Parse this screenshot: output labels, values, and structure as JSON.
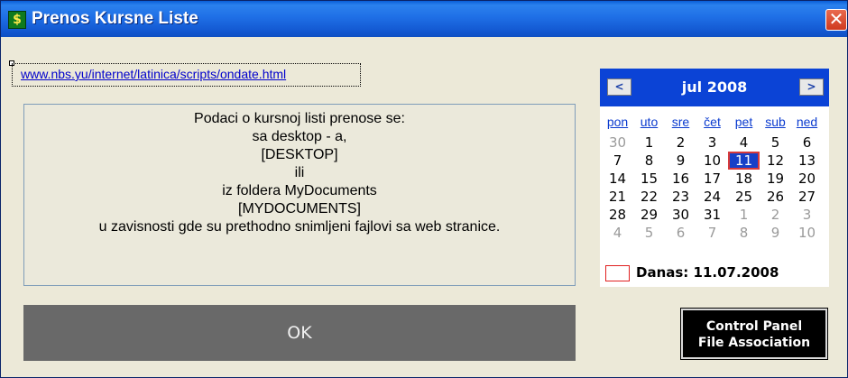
{
  "window": {
    "title": "Prenos Kursne Liste",
    "app_icon": "dollar-money-icon",
    "close_symbol": "✕"
  },
  "url_link": "www.nbs.yu/internet/latinica/scripts/ondate.html",
  "info_lines": [
    "Podaci o kursnoj listi prenose se:",
    "sa desktop - a,",
    "[DESKTOP]",
    "ili",
    "iz foldera MyDocuments",
    "[MYDOCUMENTS]",
    "u zavisnosti gde su prethodno snimljeni fajlovi sa web stranice."
  ],
  "ok_label": "OK",
  "calendar": {
    "month_label": "jul 2008",
    "prev_symbol": "<",
    "next_symbol": ">",
    "weekdays": [
      "pon",
      "uto",
      "sre",
      "čet",
      "pet",
      "sub",
      "ned"
    ],
    "weeks": [
      [
        {
          "d": "30",
          "o": true
        },
        {
          "d": "1"
        },
        {
          "d": "2"
        },
        {
          "d": "3"
        },
        {
          "d": "4"
        },
        {
          "d": "5"
        },
        {
          "d": "6"
        }
      ],
      [
        {
          "d": "7"
        },
        {
          "d": "8"
        },
        {
          "d": "9"
        },
        {
          "d": "10"
        },
        {
          "d": "11",
          "s": true
        },
        {
          "d": "12"
        },
        {
          "d": "13"
        }
      ],
      [
        {
          "d": "14"
        },
        {
          "d": "15"
        },
        {
          "d": "16"
        },
        {
          "d": "17"
        },
        {
          "d": "18"
        },
        {
          "d": "19"
        },
        {
          "d": "20"
        }
      ],
      [
        {
          "d": "21"
        },
        {
          "d": "22"
        },
        {
          "d": "23"
        },
        {
          "d": "24"
        },
        {
          "d": "25"
        },
        {
          "d": "26"
        },
        {
          "d": "27"
        }
      ],
      [
        {
          "d": "28"
        },
        {
          "d": "29"
        },
        {
          "d": "30"
        },
        {
          "d": "31"
        },
        {
          "d": "1",
          "o": true
        },
        {
          "d": "2",
          "o": true
        },
        {
          "d": "3",
          "o": true
        }
      ],
      [
        {
          "d": "4",
          "o": true
        },
        {
          "d": "5",
          "o": true
        },
        {
          "d": "6",
          "o": true
        },
        {
          "d": "7",
          "o": true
        },
        {
          "d": "8",
          "o": true
        },
        {
          "d": "9",
          "o": true
        },
        {
          "d": "10",
          "o": true
        }
      ]
    ],
    "today_label": "Danas: 11.07.2008"
  },
  "control_panel_button": {
    "line1": "Control Panel",
    "line2": "File Association"
  },
  "colors": {
    "titlebar": "#1f6fe6",
    "calendar_header": "#0b43d6",
    "ok_button": "#696969",
    "selected_day": "#1640c8"
  }
}
